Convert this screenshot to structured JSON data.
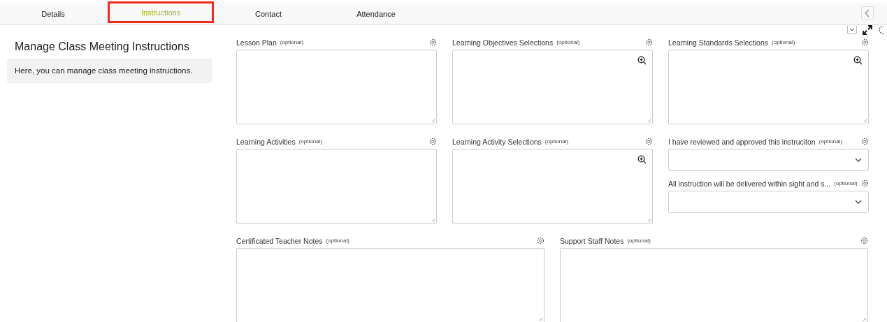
{
  "tabs": [
    {
      "label": "Details",
      "selected": false
    },
    {
      "label": "Instructions",
      "selected": true
    },
    {
      "label": "Contact",
      "selected": false
    },
    {
      "label": "Attendance",
      "selected": false
    }
  ],
  "panel": {
    "title": "Manage Class Meeting Instructions",
    "description": "Here, you can manage class meeting instructions."
  },
  "rows": [
    {
      "fields": [
        {
          "kind": "textarea",
          "label": "Lesson Plan",
          "hint": "(optional)",
          "zoom": false
        },
        {
          "kind": "textarea",
          "label": "Learning Objectives Selections",
          "hint": "(optional)",
          "zoom": true
        },
        {
          "kind": "textarea",
          "label": "Learning Standards Selections",
          "hint": "(optional)",
          "zoom": true
        }
      ]
    },
    {
      "fields": [
        {
          "kind": "textarea",
          "label": "Learning Activities",
          "hint": "(optional)",
          "zoom": false
        },
        {
          "kind": "textarea",
          "label": "Learning Activity Selections",
          "hint": "(optional)",
          "zoom": true
        },
        {
          "kind": "stack",
          "fields": [
            {
              "kind": "select",
              "label": "I have reviewed and approved this instruciton",
              "hint": "(optional)"
            },
            {
              "kind": "select",
              "label": "All instruction will be delivered within sight and s...",
              "hint": "(optional)"
            }
          ]
        }
      ]
    },
    {
      "fields": [
        {
          "kind": "textarea",
          "label": "Certificated Teacher Notes",
          "hint": "(optional)",
          "zoom": false
        },
        {
          "kind": "textarea",
          "label": "Support Staff Notes",
          "hint": "(optional)",
          "zoom": false
        }
      ]
    }
  ]
}
